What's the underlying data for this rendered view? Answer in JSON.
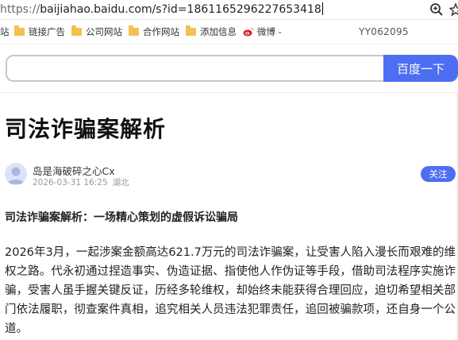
{
  "browser": {
    "url_scheme": "https://",
    "url_rest": "baijiahao.baidu.com/s?id=1861165296227653418",
    "zoom_icon": "zoom-in-icon",
    "bookmark_star_icon": "star-icon"
  },
  "bookmarks": {
    "items": [
      {
        "label": "站",
        "icon": "folder-icon"
      },
      {
        "label": "链接广告",
        "icon": "folder-icon"
      },
      {
        "label": "公司网站",
        "icon": "folder-icon"
      },
      {
        "label": "合作网站",
        "icon": "folder-icon"
      },
      {
        "label": "添加信息",
        "icon": "folder-icon"
      },
      {
        "label": "微博 -",
        "icon": "weibo-icon"
      }
    ],
    "user_id": "YY062095"
  },
  "search": {
    "value": "",
    "button_label": "百度一下",
    "accent": "#4e6ef2"
  },
  "article": {
    "title": "司法诈骗案解析",
    "author": "岛是海破碎之心Cx",
    "date": "2026-03-31 16:25",
    "location": "湖北",
    "follow_label": "关注",
    "subheading": "司法诈骗案解析：一场精心策划的虚假诉讼骗局",
    "paragraph": "2026年3月，一起涉案金额高达621.7万元的司法诈骗案，让受害人陷入漫长而艰难的维权之路。代永初通过捏造事实、伪造证据、指使他人作伪证等手段，借助司法程序实施诈骗，受害人虽手握关键反证，历经多轮维权，却始终未能获得合理回应，迫切希望相关部门依法履职，彻查案件真相，追究相关人员违法犯罪责任，追回被骗款项，还自身一个公道。"
  }
}
